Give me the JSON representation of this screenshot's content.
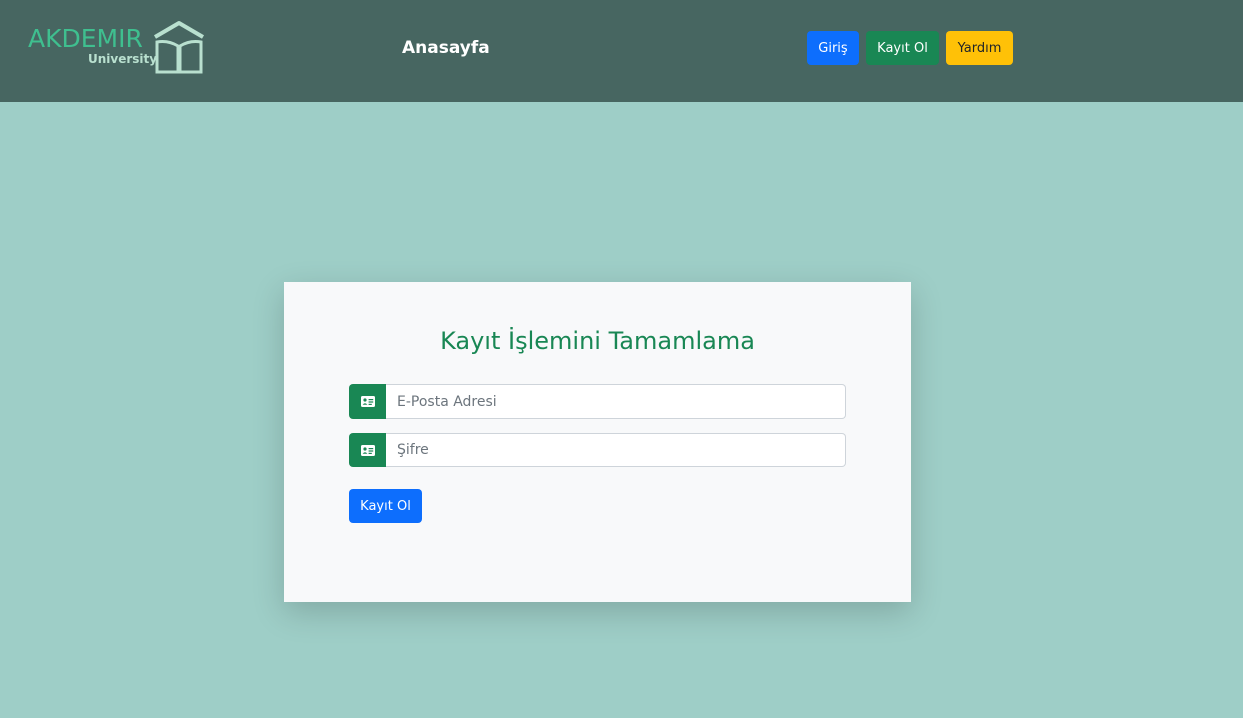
{
  "brand": {
    "name": "AKDEMIR",
    "subtitle": "University",
    "icon": "open-book-house-icon",
    "colors": {
      "name": "#3fbf8f",
      "icon": "#b9e0cf"
    }
  },
  "nav": {
    "home_label": "Anasayfa",
    "login_label": "Giriş",
    "register_label": "Kayıt Ol",
    "help_label": "Yardım"
  },
  "form": {
    "title": "Kayıt İşlemini Tamamlama",
    "email": {
      "placeholder": "E-Posta Adresi",
      "value": "",
      "icon": "id-card-icon"
    },
    "password": {
      "placeholder": "Şifre",
      "value": "",
      "icon": "id-card-icon"
    },
    "submit_label": "Kayıt Ol"
  },
  "colors": {
    "page_bg": "#9ecec7",
    "navbar_bg": "#476661",
    "primary": "#0d6efd",
    "success": "#198754",
    "warning": "#ffc107",
    "card_bg": "#f8f9fa"
  }
}
